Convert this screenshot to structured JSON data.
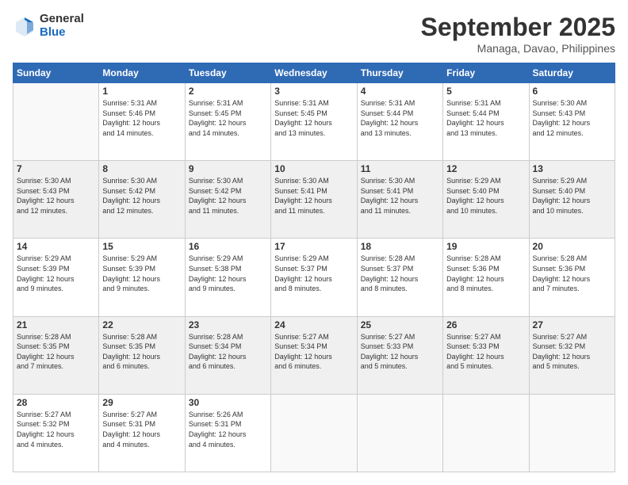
{
  "logo": {
    "general": "General",
    "blue": "Blue"
  },
  "header": {
    "month": "September 2025",
    "location": "Managa, Davao, Philippines"
  },
  "days_of_week": [
    "Sunday",
    "Monday",
    "Tuesday",
    "Wednesday",
    "Thursday",
    "Friday",
    "Saturday"
  ],
  "weeks": [
    [
      {
        "day": "",
        "info": ""
      },
      {
        "day": "1",
        "info": "Sunrise: 5:31 AM\nSunset: 5:46 PM\nDaylight: 12 hours\nand 14 minutes."
      },
      {
        "day": "2",
        "info": "Sunrise: 5:31 AM\nSunset: 5:45 PM\nDaylight: 12 hours\nand 14 minutes."
      },
      {
        "day": "3",
        "info": "Sunrise: 5:31 AM\nSunset: 5:45 PM\nDaylight: 12 hours\nand 13 minutes."
      },
      {
        "day": "4",
        "info": "Sunrise: 5:31 AM\nSunset: 5:44 PM\nDaylight: 12 hours\nand 13 minutes."
      },
      {
        "day": "5",
        "info": "Sunrise: 5:31 AM\nSunset: 5:44 PM\nDaylight: 12 hours\nand 13 minutes."
      },
      {
        "day": "6",
        "info": "Sunrise: 5:30 AM\nSunset: 5:43 PM\nDaylight: 12 hours\nand 12 minutes."
      }
    ],
    [
      {
        "day": "7",
        "info": "Sunrise: 5:30 AM\nSunset: 5:43 PM\nDaylight: 12 hours\nand 12 minutes."
      },
      {
        "day": "8",
        "info": "Sunrise: 5:30 AM\nSunset: 5:42 PM\nDaylight: 12 hours\nand 12 minutes."
      },
      {
        "day": "9",
        "info": "Sunrise: 5:30 AM\nSunset: 5:42 PM\nDaylight: 12 hours\nand 11 minutes."
      },
      {
        "day": "10",
        "info": "Sunrise: 5:30 AM\nSunset: 5:41 PM\nDaylight: 12 hours\nand 11 minutes."
      },
      {
        "day": "11",
        "info": "Sunrise: 5:30 AM\nSunset: 5:41 PM\nDaylight: 12 hours\nand 11 minutes."
      },
      {
        "day": "12",
        "info": "Sunrise: 5:29 AM\nSunset: 5:40 PM\nDaylight: 12 hours\nand 10 minutes."
      },
      {
        "day": "13",
        "info": "Sunrise: 5:29 AM\nSunset: 5:40 PM\nDaylight: 12 hours\nand 10 minutes."
      }
    ],
    [
      {
        "day": "14",
        "info": "Sunrise: 5:29 AM\nSunset: 5:39 PM\nDaylight: 12 hours\nand 9 minutes."
      },
      {
        "day": "15",
        "info": "Sunrise: 5:29 AM\nSunset: 5:39 PM\nDaylight: 12 hours\nand 9 minutes."
      },
      {
        "day": "16",
        "info": "Sunrise: 5:29 AM\nSunset: 5:38 PM\nDaylight: 12 hours\nand 9 minutes."
      },
      {
        "day": "17",
        "info": "Sunrise: 5:29 AM\nSunset: 5:37 PM\nDaylight: 12 hours\nand 8 minutes."
      },
      {
        "day": "18",
        "info": "Sunrise: 5:28 AM\nSunset: 5:37 PM\nDaylight: 12 hours\nand 8 minutes."
      },
      {
        "day": "19",
        "info": "Sunrise: 5:28 AM\nSunset: 5:36 PM\nDaylight: 12 hours\nand 8 minutes."
      },
      {
        "day": "20",
        "info": "Sunrise: 5:28 AM\nSunset: 5:36 PM\nDaylight: 12 hours\nand 7 minutes."
      }
    ],
    [
      {
        "day": "21",
        "info": "Sunrise: 5:28 AM\nSunset: 5:35 PM\nDaylight: 12 hours\nand 7 minutes."
      },
      {
        "day": "22",
        "info": "Sunrise: 5:28 AM\nSunset: 5:35 PM\nDaylight: 12 hours\nand 6 minutes."
      },
      {
        "day": "23",
        "info": "Sunrise: 5:28 AM\nSunset: 5:34 PM\nDaylight: 12 hours\nand 6 minutes."
      },
      {
        "day": "24",
        "info": "Sunrise: 5:27 AM\nSunset: 5:34 PM\nDaylight: 12 hours\nand 6 minutes."
      },
      {
        "day": "25",
        "info": "Sunrise: 5:27 AM\nSunset: 5:33 PM\nDaylight: 12 hours\nand 5 minutes."
      },
      {
        "day": "26",
        "info": "Sunrise: 5:27 AM\nSunset: 5:33 PM\nDaylight: 12 hours\nand 5 minutes."
      },
      {
        "day": "27",
        "info": "Sunrise: 5:27 AM\nSunset: 5:32 PM\nDaylight: 12 hours\nand 5 minutes."
      }
    ],
    [
      {
        "day": "28",
        "info": "Sunrise: 5:27 AM\nSunset: 5:32 PM\nDaylight: 12 hours\nand 4 minutes."
      },
      {
        "day": "29",
        "info": "Sunrise: 5:27 AM\nSunset: 5:31 PM\nDaylight: 12 hours\nand 4 minutes."
      },
      {
        "day": "30",
        "info": "Sunrise: 5:26 AM\nSunset: 5:31 PM\nDaylight: 12 hours\nand 4 minutes."
      },
      {
        "day": "",
        "info": ""
      },
      {
        "day": "",
        "info": ""
      },
      {
        "day": "",
        "info": ""
      },
      {
        "day": "",
        "info": ""
      }
    ]
  ]
}
